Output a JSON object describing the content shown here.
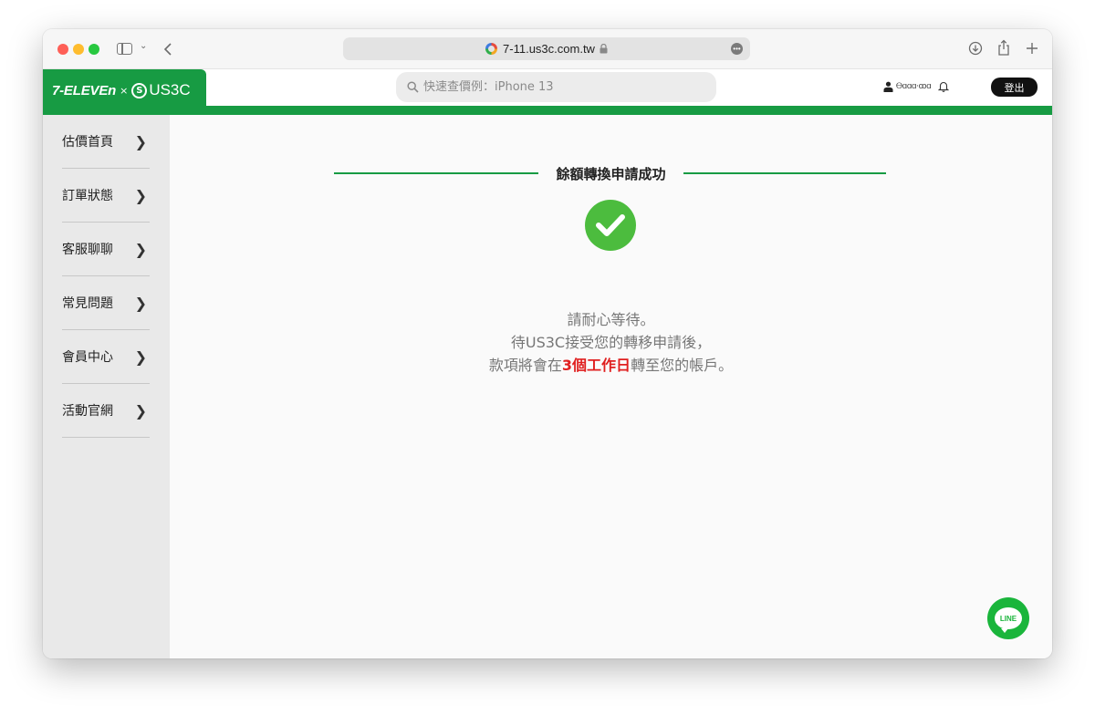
{
  "browser": {
    "url": "7-11.us3c.com.tw",
    "nav_down_icon": "chevron-down-icon",
    "back_icon": "chevron-left-icon"
  },
  "header": {
    "logo_711": "7-ELEVEn",
    "logo_x": "×",
    "logo_us3c_mark": "S",
    "logo_us3c": "US3C",
    "search_placeholder": "快速查價例：iPhone 13",
    "user_name": "Ꮎɑɑɑ·ꝏɑ",
    "logout_label": "登出"
  },
  "sidebar": {
    "items": [
      {
        "label": "估價首頁"
      },
      {
        "label": "訂單狀態"
      },
      {
        "label": "客服聊聊"
      },
      {
        "label": "常見問題"
      },
      {
        "label": "會員中心"
      },
      {
        "label": "活動官網"
      }
    ]
  },
  "main": {
    "title": "餘額轉換申請成功",
    "line1": "請耐心等待。",
    "line2": "待US3C接受您的轉移申請後，",
    "line3_before": "款項將會在",
    "line3_highlight": "3個工作日",
    "line3_after": "轉至您的帳戶。"
  },
  "line_button": {
    "label": "LINE"
  },
  "colors": {
    "brand_green": "#179b43",
    "check_green": "#4cbc3e",
    "highlight_red": "#e02020"
  }
}
